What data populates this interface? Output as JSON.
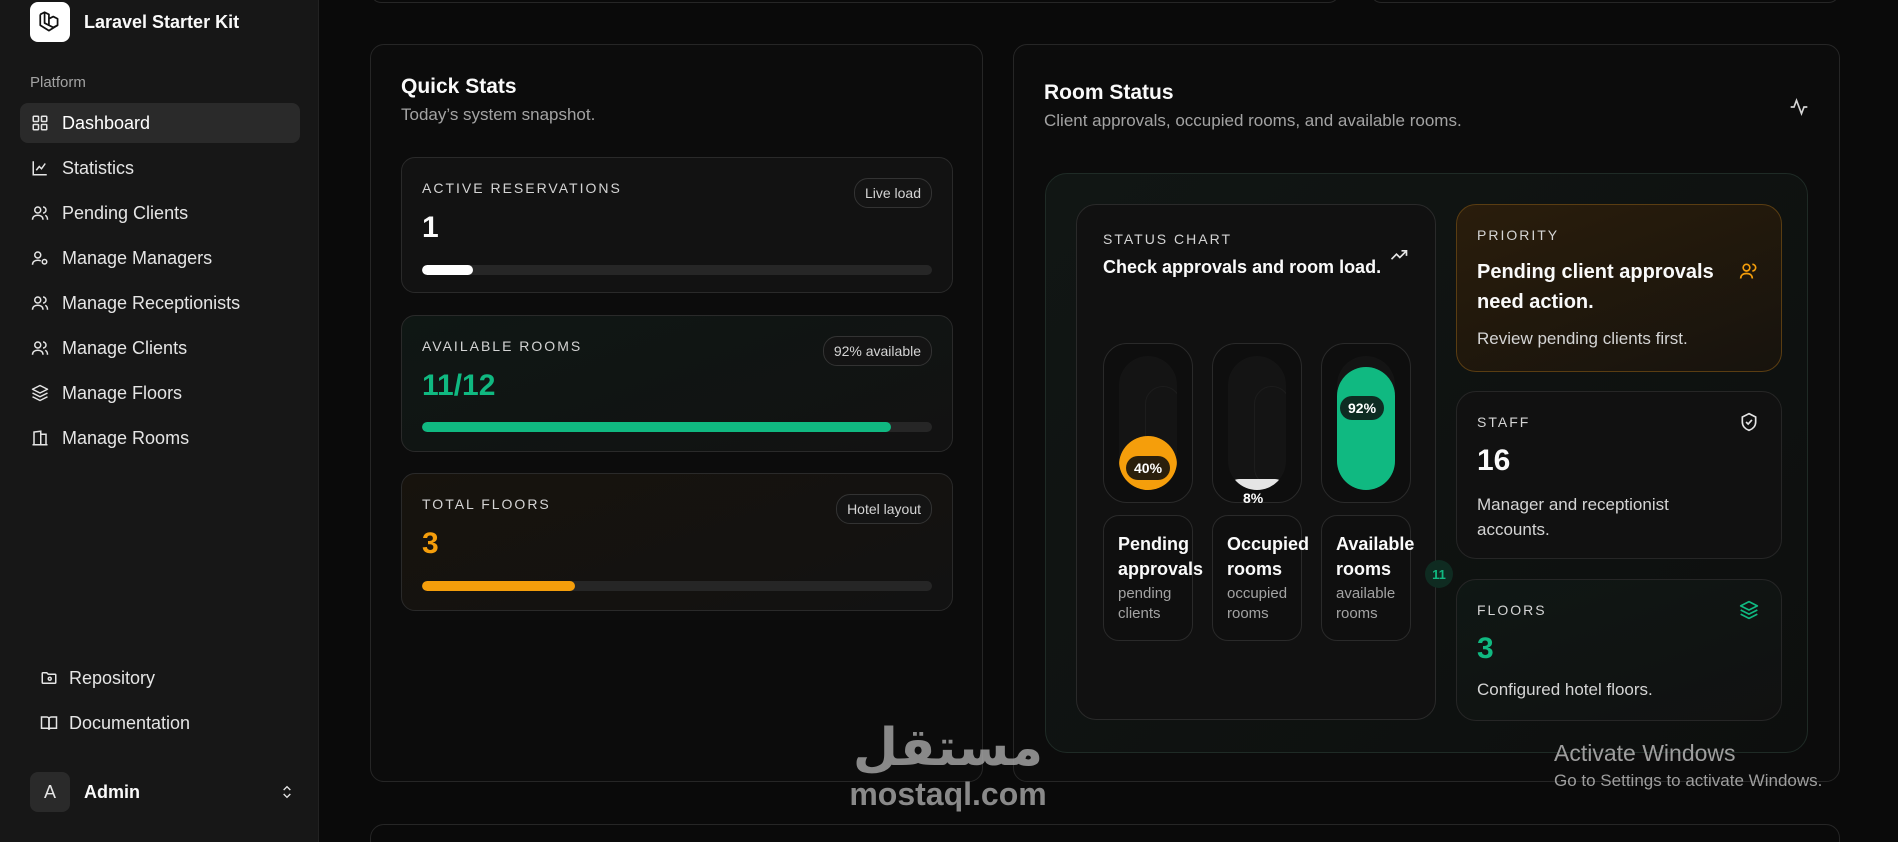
{
  "sidebar": {
    "brand": "Laravel Starter Kit",
    "section": "Platform",
    "items": [
      {
        "label": "Dashboard",
        "icon": "dashboard-grid-icon"
      },
      {
        "label": "Statistics",
        "icon": "chart-icon"
      },
      {
        "label": "Pending Clients",
        "icon": "users-icon"
      },
      {
        "label": "Manage Managers",
        "icon": "user-cog-icon"
      },
      {
        "label": "Manage Receptionists",
        "icon": "users-icon"
      },
      {
        "label": "Manage Clients",
        "icon": "users-icon"
      },
      {
        "label": "Manage Floors",
        "icon": "layers-icon"
      },
      {
        "label": "Manage Rooms",
        "icon": "building-icon"
      }
    ],
    "footer": [
      {
        "label": "Repository",
        "icon": "folder-git-icon"
      },
      {
        "label": "Documentation",
        "icon": "book-icon"
      }
    ],
    "user": {
      "initial": "A",
      "name": "Admin"
    }
  },
  "quick_stats": {
    "title": "Quick Stats",
    "subtitle": "Today’s system snapshot.",
    "cards": [
      {
        "label": "ACTIVE RESERVATIONS",
        "badge": "Live load",
        "value": "1",
        "progress": 0.1,
        "color": "#ffffff"
      },
      {
        "label": "AVAILABLE ROOMS",
        "badge": "92% available",
        "value": "11/12",
        "progress": 0.92,
        "color": "#10b981"
      },
      {
        "label": "TOTAL FLOORS",
        "badge": "Hotel layout",
        "value": "3",
        "progress": 0.3,
        "color": "#f59e0b"
      }
    ]
  },
  "room_status": {
    "title": "Room Status",
    "subtitle": "Client approvals, occupied rooms, and available rooms.",
    "chart": {
      "label": "STATUS CHART",
      "title": "Check approvals and room load.",
      "columns": [
        {
          "pct_label": "40%",
          "level": 0.4,
          "title": "Pending approvals",
          "sub": "pending clients",
          "color": "#f59e0b"
        },
        {
          "pct_label": "8%",
          "level": 0.08,
          "title": "Occupied rooms",
          "sub": "occupied rooms",
          "color": "#e5e5e5"
        },
        {
          "pct_label": "92%",
          "level": 0.92,
          "title": "Available rooms",
          "sub": "available rooms",
          "color": "#10b981",
          "count": "11"
        }
      ]
    },
    "priority": {
      "label": "PRIORITY",
      "title": "Pending client approvals need action.",
      "text": "Review pending clients first."
    },
    "staff": {
      "label": "STAFF",
      "value": "16",
      "text": "Manager and receptionist accounts."
    },
    "floors": {
      "label": "FLOORS",
      "value": "3",
      "text": "Configured hotel floors."
    }
  },
  "system": {
    "activate_title": "Activate Windows",
    "activate_sub": "Go to Settings to activate Windows.",
    "watermark_ar": "مستقل",
    "watermark_en": "mostaql.com"
  },
  "colors": {
    "accent_green": "#10b981",
    "accent_orange": "#f59e0b",
    "background": "#0a0a0a"
  }
}
